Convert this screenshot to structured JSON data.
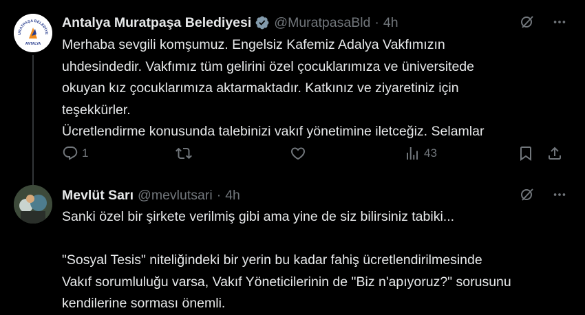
{
  "tweets": [
    {
      "author_name": "Antalya Muratpaşa Belediyesi",
      "handle": "@MuratpasaBld",
      "separator": "·",
      "time": "4h",
      "verified": true,
      "avatar_logo_text": "MURATPAŞA BELEDİYESİ ANTALYA",
      "text_lines": [
        "Merhaba sevgili komşumuz. Engelsiz Kafemiz Adalya Vakfımızın",
        "uhdesindedir. Vakfımız tüm gelirini özel çocuklarımıza ve üniversitede",
        "okuyan kız çocuklarımıza aktarmaktadır. Katkınız ve ziyaretiniz için",
        "teşekkürler.",
        "Ücretlendirme konusunda talebinizi vakıf yönetimine iletceğiz. Selamlar"
      ],
      "actions": {
        "reply_count": "1",
        "retweet_count": "",
        "like_count": "",
        "views_count": "43"
      }
    },
    {
      "author_name": "Mevlüt Sarı",
      "handle": "@mevlutsari",
      "separator": "·",
      "time": "4h",
      "verified": false,
      "text_lines": [
        "Sanki özel bir şirkete verilmiş gibi ama yine de siz bilirsiniz tabiki...",
        "",
        "\"Sosyal Tesis\" niteliğindeki bir yerin bu kadar fahiş ücretlendirilmesinde",
        "Vakıf sorumluluğu varsa, Vakıf Yöneticilerinin de \"Biz n'apıyoruz?\" sorusunu",
        "kendilerine sorması önemli."
      ]
    }
  ],
  "icons": {
    "grok": "grok-icon",
    "more": "more-icon",
    "verified": "verified-badge-icon",
    "reply": "reply-icon",
    "retweet": "retweet-icon",
    "like": "like-icon",
    "views": "views-icon",
    "bookmark": "bookmark-icon",
    "share": "share-icon"
  },
  "colors": {
    "background": "#000000",
    "text": "#e7e9ea",
    "secondary": "#71767b",
    "verified": "#829aab"
  }
}
